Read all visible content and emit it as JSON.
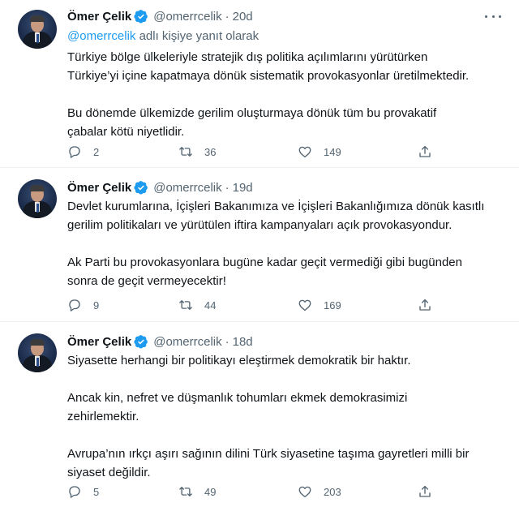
{
  "tweets": [
    {
      "author": {
        "name": "Ömer Çelik",
        "handle": "@omerrcelik"
      },
      "separator": "·",
      "date": "20d",
      "reply_to": {
        "mention": "@omerrcelik",
        "suffix": " adlı kişiye yanıt olarak"
      },
      "paragraphs": [
        [
          "Türkiye bölge ülkeleriyle  stratejik dış politika açılımlarını  yürütürken",
          "Türkiye’yi içine kapatmaya dönük sistematik provokasyonlar üretilmektedir."
        ],
        [
          "Bu dönemde ülkemizde gerilim oluşturmaya dönük tüm bu provakatif",
          "çabalar kötü niyetlidir."
        ]
      ],
      "stats": {
        "replies": "2",
        "retweets": "36",
        "likes": "149"
      }
    },
    {
      "author": {
        "name": "Ömer Çelik",
        "handle": "@omerrcelik"
      },
      "separator": "·",
      "date": "19d",
      "paragraphs": [
        [
          "Devlet kurumlarına, İçişleri Bakanımıza ve İçişleri Bakanlığımıza dönük kasıtlı",
          "gerilim politikaları ve yürütülen iftira kampanyaları açık provokasyondur."
        ],
        [
          "Ak Parti bu provokasyonlara bugüne kadar geçit vermediği gibi bugünden",
          "sonra de geçit vermeyecektir!"
        ]
      ],
      "stats": {
        "replies": "9",
        "retweets": "44",
        "likes": "169"
      }
    },
    {
      "author": {
        "name": "Ömer Çelik",
        "handle": "@omerrcelik"
      },
      "separator": "·",
      "date": "18d",
      "paragraphs": [
        [
          "Siyasette herhangi bir politikayı eleştirmek demokratik bir haktır."
        ],
        [
          "Ancak kin, nefret ve düşmanlık tohumları ekmek demokrasimizi",
          "zehirlemektir."
        ],
        [
          "Avrupa’nın ırkçı aşırı sağının dilini Türk siyasetine taşıma gayretleri milli bir",
          "siyaset değildir."
        ]
      ],
      "stats": {
        "replies": "5",
        "retweets": "49",
        "likes": "203"
      }
    }
  ],
  "icons": {
    "verified": "verified-badge-icon",
    "more": "more-dots-icon",
    "reply": "reply-bubble-icon",
    "retweet": "retweet-arrows-icon",
    "like": "heart-outline-icon",
    "share": "share-upload-icon"
  },
  "colors": {
    "accent": "#1d9bf0",
    "text": "#0f1419",
    "secondary": "#536471",
    "divider": "#eff3f4"
  }
}
